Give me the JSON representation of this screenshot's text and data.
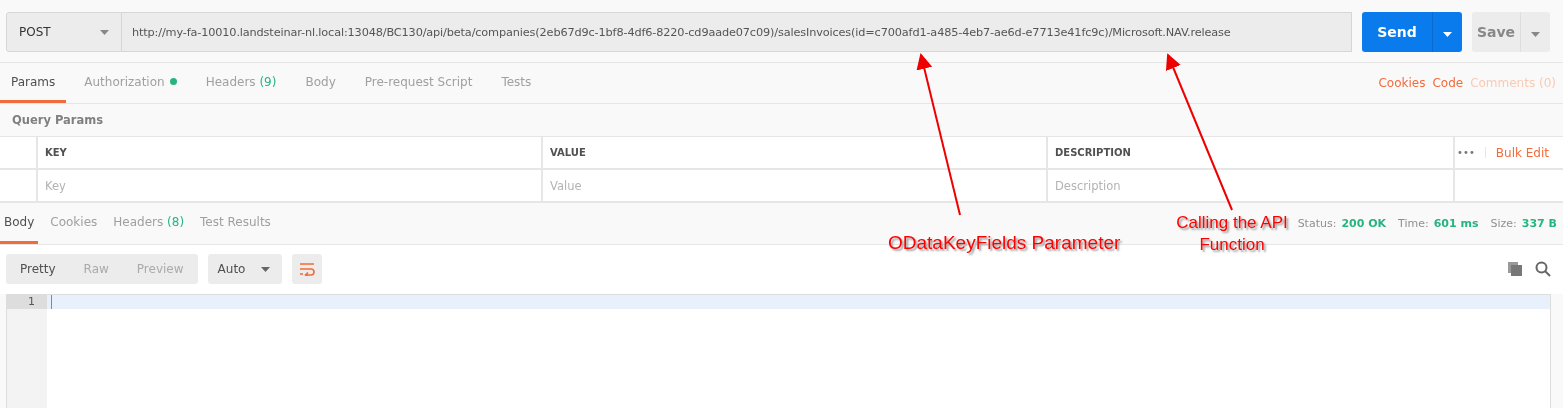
{
  "request": {
    "method": "POST",
    "url": "http://my-fa-10010.landsteinar-nl.local:13048/BC130/api/beta/companies(2eb67d9c-1bf8-4df6-8220-cd9aade07c09)/salesInvoices(id=c700afd1-a485-4eb7-ae6d-e7713e41fc9c)/Microsoft.NAV.release"
  },
  "send_button": "Send",
  "save_button": "Save",
  "request_tabs": [
    {
      "label": "Params",
      "selected": true,
      "dot": false
    },
    {
      "label": "Authorization",
      "selected": false,
      "dot": true
    },
    {
      "label": "Headers",
      "count": "(9)",
      "selected": false,
      "dot": false
    },
    {
      "label": "Body",
      "selected": false,
      "dot": false
    },
    {
      "label": "Pre-request Script",
      "selected": false,
      "dot": false
    },
    {
      "label": "Tests",
      "selected": false,
      "dot": false
    }
  ],
  "right_links": [
    {
      "label": "Cookies",
      "disabled": false
    },
    {
      "label": "Code",
      "disabled": false
    },
    {
      "label": "Comments (0)",
      "disabled": true
    }
  ],
  "query_params": {
    "title": "Query Params",
    "columns": [
      {
        "label": "KEY",
        "placeholder": "Key"
      },
      {
        "label": "VALUE",
        "placeholder": "Value"
      },
      {
        "label": "DESCRIPTION",
        "placeholder": "Description"
      }
    ],
    "more": "•••",
    "bulk_edit": "Bulk Edit"
  },
  "response_tabs": [
    {
      "label": "Body",
      "selected": true
    },
    {
      "label": "Cookies",
      "selected": false
    },
    {
      "label": "Headers",
      "count": "(8)",
      "selected": false
    },
    {
      "label": "Test Results",
      "selected": false
    }
  ],
  "status": [
    {
      "label": "Status:",
      "value": "200 OK"
    },
    {
      "label": "Time:",
      "value": "601 ms"
    },
    {
      "label": "Size:",
      "value": "337 B"
    }
  ],
  "view_modes": [
    {
      "label": "Pretty",
      "selected": true
    },
    {
      "label": "Raw",
      "selected": false
    },
    {
      "label": "Preview",
      "selected": false
    }
  ],
  "format": "Auto",
  "editor": {
    "line_numbers": [
      "1"
    ]
  },
  "annotations": [
    "ODataKeyFields Parameter",
    "Calling the API Function"
  ]
}
